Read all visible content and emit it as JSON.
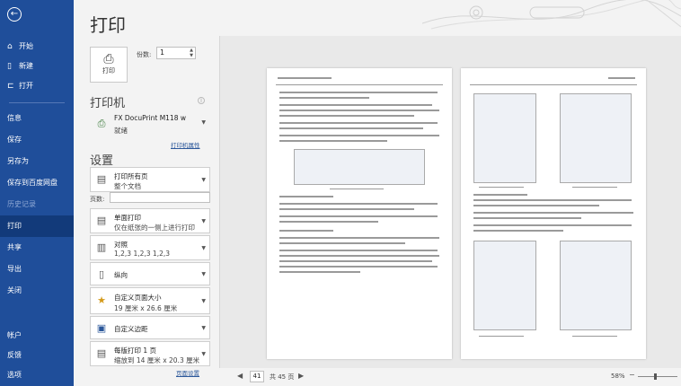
{
  "sidebar": {
    "items": [
      {
        "icon": "home-icon",
        "label": "开始"
      },
      {
        "icon": "new-doc-icon",
        "label": "新建"
      },
      {
        "icon": "open-folder-icon",
        "label": "打开"
      },
      {
        "label": "信息"
      },
      {
        "label": "保存"
      },
      {
        "label": "另存为"
      },
      {
        "label": "保存到百度网盘"
      },
      {
        "label": "历史记录"
      },
      {
        "label": "打印"
      },
      {
        "label": "共享"
      },
      {
        "label": "导出"
      },
      {
        "label": "关闭"
      },
      {
        "label": "帐户"
      },
      {
        "label": "反馈"
      },
      {
        "label": "选项"
      }
    ]
  },
  "title": "打印",
  "print": {
    "button_label": "打印",
    "copies_label": "份数:",
    "copies_value": "1"
  },
  "printer": {
    "heading": "打印机",
    "name": "FX DocuPrint M118 w",
    "status": "就绪",
    "properties_link": "打印机属性"
  },
  "settings": {
    "heading": "设置",
    "print_range": {
      "line1": "打印所有页",
      "line2": "整个文档"
    },
    "pages_label": "页数:",
    "pages_value": "",
    "sides": {
      "line1": "单面打印",
      "line2": "仅在纸张的一侧上进行打印"
    },
    "collate": {
      "line1": "对照",
      "line2": "1,2,3   1,2,3   1,2,3"
    },
    "orientation": {
      "line1": "纵向"
    },
    "paper_size": {
      "line1": "自定义页面大小",
      "line2": "19 厘米 x 26.6 厘米"
    },
    "margins": {
      "line1": "自定义边距"
    },
    "pages_per_sheet": {
      "line1": "每版打印 1 页",
      "line2": "缩放到 14 厘米 x 20.3 厘米"
    },
    "page_setup_link": "页面设置"
  },
  "preview": {
    "page_number": "41",
    "total_pages": "共 45 页",
    "zoom_level": "58%"
  }
}
